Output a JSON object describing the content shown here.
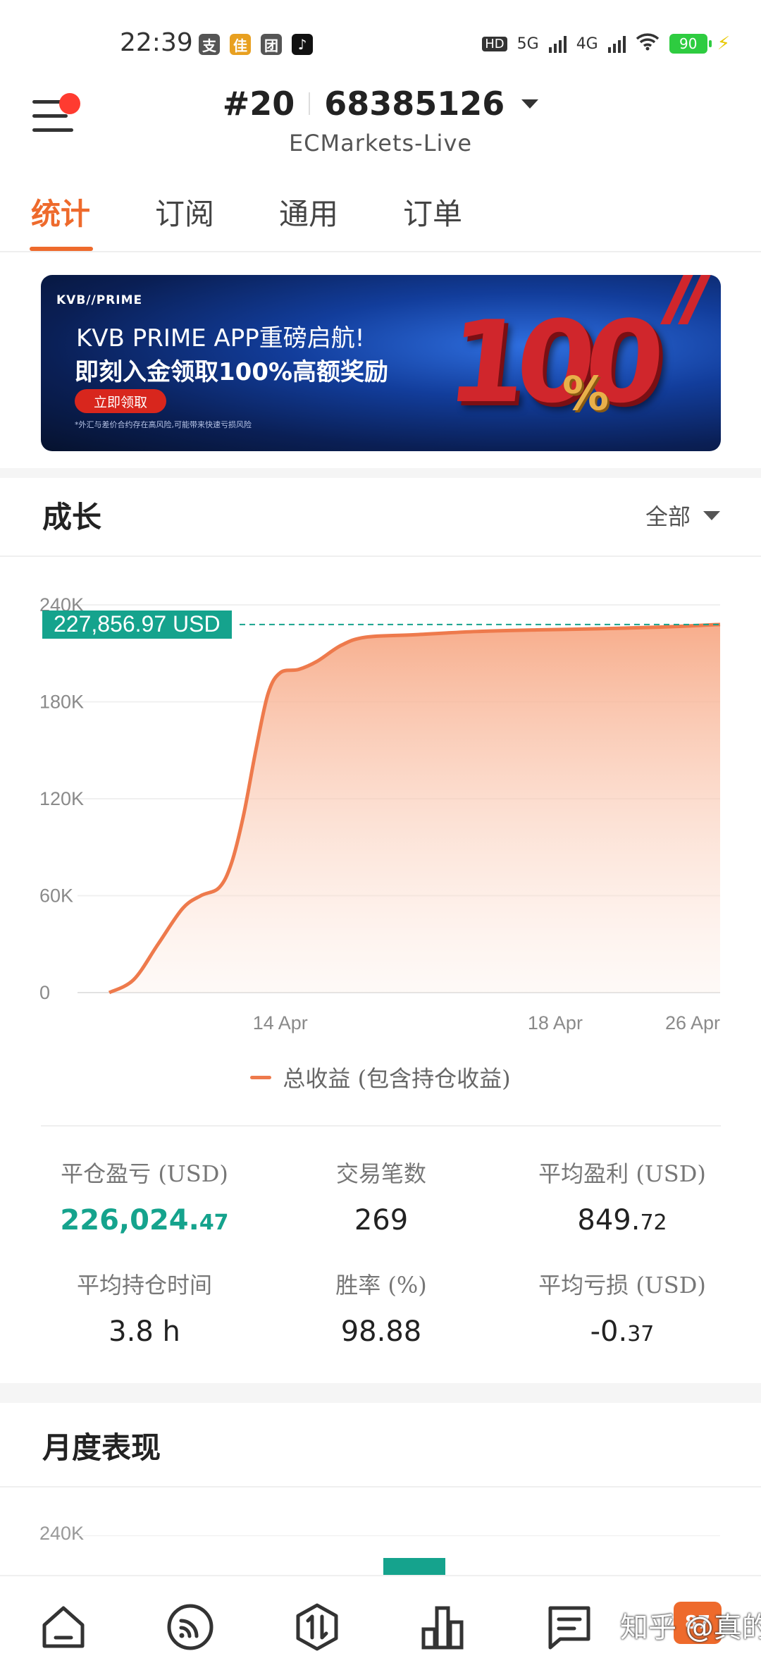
{
  "status_bar": {
    "time": "22:39",
    "notifications": [
      "支",
      "佳",
      "团",
      "♪"
    ],
    "hd_label": "HD",
    "net1": "5G",
    "net2": "4G",
    "battery": "90"
  },
  "header": {
    "account_prefix": "#20",
    "account_number": "68385126",
    "server": "ECMarkets-Live"
  },
  "tabs": [
    "统计",
    "订阅",
    "通用",
    "订单"
  ],
  "banner": {
    "logo": "KVB//PRIME",
    "line1": "KVB PRIME APP重磅启航!",
    "line2": "即刻入金领取100%高额奖励",
    "button": "立即领取",
    "fine_print": "*外汇与差价合约存在高风险,可能带来快速亏损风险",
    "big_number": "100",
    "percent": "%"
  },
  "growth": {
    "title": "成长",
    "range": "全部",
    "current_value_label": "227,856.97 USD",
    "legend": "总收益 (包含持仓收益)"
  },
  "chart_data": {
    "type": "area",
    "yticks": [
      "240K",
      "180K",
      "120K",
      "60K",
      "0"
    ],
    "ylim": [
      0,
      240000
    ],
    "xticks": [
      "14 Apr",
      "18 Apr",
      "26 Apr"
    ],
    "series": [
      {
        "name": "总收益 (包含持仓收益)",
        "points": [
          [
            0,
            0
          ],
          [
            0.04,
            8000
          ],
          [
            0.08,
            30000
          ],
          [
            0.12,
            52000
          ],
          [
            0.15,
            60000
          ],
          [
            0.18,
            65000
          ],
          [
            0.2,
            80000
          ],
          [
            0.22,
            110000
          ],
          [
            0.24,
            150000
          ],
          [
            0.26,
            185000
          ],
          [
            0.28,
            198000
          ],
          [
            0.31,
            200000
          ],
          [
            0.34,
            205000
          ],
          [
            0.38,
            215000
          ],
          [
            0.42,
            220000
          ],
          [
            0.5,
            221500
          ],
          [
            0.6,
            223500
          ],
          [
            0.7,
            224500
          ],
          [
            0.8,
            225200
          ],
          [
            0.9,
            226200
          ],
          [
            1.0,
            227856.97
          ]
        ]
      }
    ],
    "current_value": 227856.97,
    "colors": {
      "line": "#ee7a4c",
      "fill_top": "#f7b89a",
      "marker": "#15a38d"
    }
  },
  "stats": [
    {
      "label": "平仓盈亏 (USD)",
      "value_main": "226,024.",
      "value_small": "47",
      "accent": true
    },
    {
      "label": "交易笔数",
      "value_main": "269",
      "value_small": "",
      "accent": false
    },
    {
      "label": "平均盈利 (USD)",
      "value_main": "849.",
      "value_small": "72",
      "accent": false
    },
    {
      "label": "平均持仓时间",
      "value_main": "3.8 h",
      "value_small": "",
      "accent": false
    },
    {
      "label": "胜率 (%)",
      "value_main": "98.88",
      "value_small": "",
      "accent": false
    },
    {
      "label": "平均亏损 (USD)",
      "value_main": "-0.",
      "value_small": "37",
      "accent": false
    }
  ],
  "monthly": {
    "title": "月度表现",
    "tick": "240K"
  },
  "bottom_nav": {
    "items": [
      "home-icon",
      "signal-icon",
      "trade-icon",
      "chart-icon",
      "message-icon"
    ],
    "badge": "87",
    "watermark": "知乎 @真的猛"
  }
}
